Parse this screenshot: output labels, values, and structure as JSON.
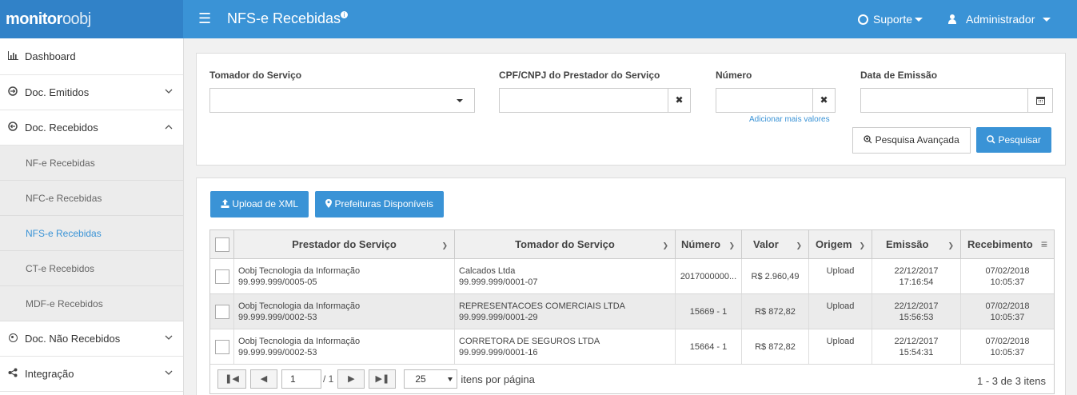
{
  "topbar": {
    "logo_a": "monitor",
    "logo_b": "oobj",
    "title": "NFS-e Recebidas",
    "title_badge": "i",
    "support_label": "Suporte",
    "user_label": "Administrador"
  },
  "sidebar": {
    "items": [
      {
        "label": "Dashboard"
      },
      {
        "label": "Doc. Emitidos"
      },
      {
        "label": "Doc. Recebidos"
      },
      {
        "label": "Doc. Não Recebidos"
      },
      {
        "label": "Integração"
      }
    ],
    "sub_items": [
      {
        "label": "NF-e Recebidas"
      },
      {
        "label": "NFC-e Recebidas"
      },
      {
        "label": "NFS-e Recebidas"
      },
      {
        "label": "CT-e Recebidos"
      },
      {
        "label": "MDF-e Recebidos"
      }
    ]
  },
  "filters": {
    "tomador_label": "Tomador do Serviço",
    "cpf_label": "CPF/CNPJ do Prestador do Serviço",
    "numero_label": "Número",
    "data_label": "Data de Emissão",
    "add_more_link": "Adicionar mais valores",
    "advanced_button": "Pesquisa Avançada",
    "search_button": "Pesquisar",
    "clear_glyph": "✖"
  },
  "actions": {
    "upload_button": "Upload de XML",
    "prefeituras_button": "Prefeituras Disponíveis"
  },
  "grid": {
    "columns": [
      "Prestador do Serviço",
      "Tomador do Serviço",
      "Número",
      "Valor",
      "Origem",
      "Emissão",
      "Recebimento"
    ],
    "rows": [
      {
        "prestador": "Oobj Tecnologia da Informação",
        "prestador_doc": "99.999.999/0005-05",
        "tomador": "Calcados Ltda",
        "tomador_doc": "99.999.999/0001-07",
        "numero": "2017000000...",
        "valor": "R$ 2.960,49",
        "origem": "Upload",
        "emissao_date": "22/12/2017",
        "emissao_time": "17:16:54",
        "receb_date": "07/02/2018",
        "receb_time": "10:05:37"
      },
      {
        "prestador": "Oobj Tecnologia da Informação",
        "prestador_doc": "99.999.999/0002-53",
        "tomador": "REPRESENTACOES COMERCIAIS LTDA",
        "tomador_doc": "99.999.999/0001-29",
        "numero": "15669 - 1",
        "valor": "R$ 872,82",
        "origem": "Upload",
        "emissao_date": "22/12/2017",
        "emissao_time": "15:56:53",
        "receb_date": "07/02/2018",
        "receb_time": "10:05:37"
      },
      {
        "prestador": "Oobj Tecnologia da Informação",
        "prestador_doc": "99.999.999/0002-53",
        "tomador": "CORRETORA DE SEGUROS LTDA",
        "tomador_doc": "99.999.999/0001-16",
        "numero": "15664 - 1",
        "valor": "R$ 872,82",
        "origem": "Upload",
        "emissao_date": "22/12/2017",
        "emissao_time": "15:54:31",
        "receb_date": "07/02/2018",
        "receb_time": "10:05:37"
      }
    ]
  },
  "pager": {
    "page": "1",
    "of_pages": "/ 1",
    "page_size": "25",
    "per_page_label": "itens por página",
    "summary": "1 - 3 de 3 itens"
  }
}
